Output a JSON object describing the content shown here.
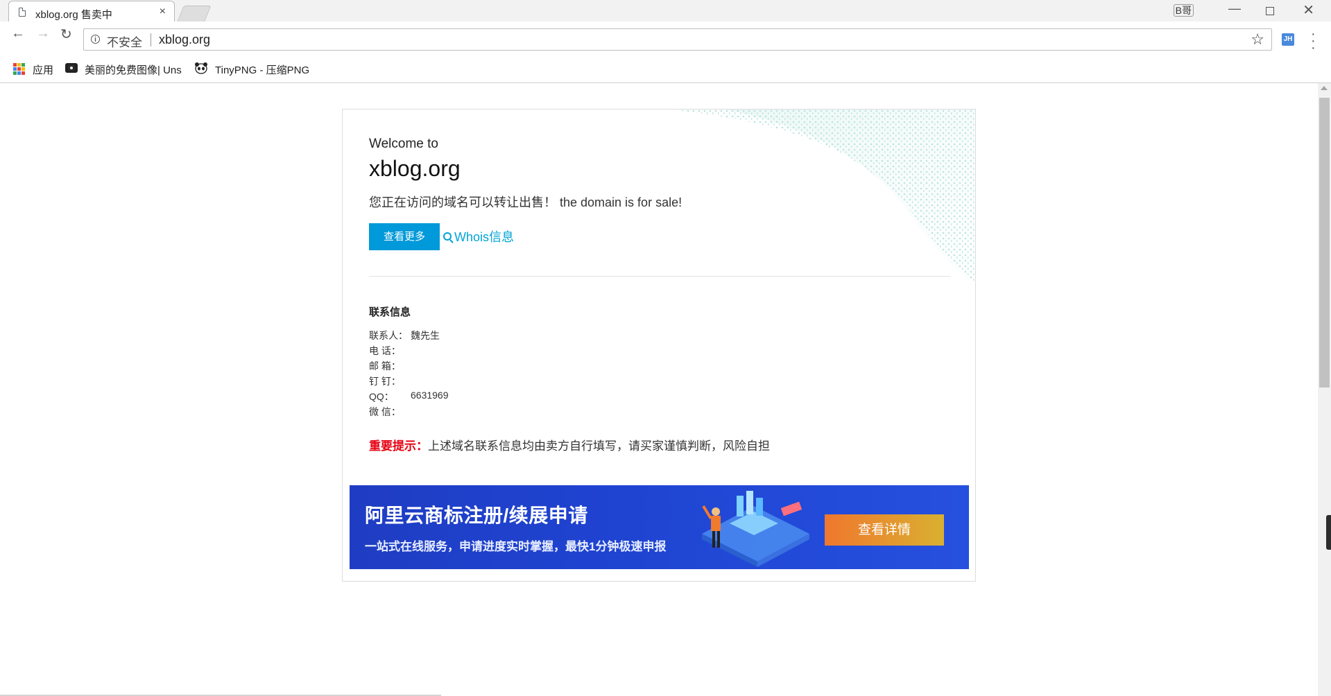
{
  "browser": {
    "tab_title": "xblog.org 售卖中",
    "tab_close": "×",
    "user_badge": "B哥",
    "window_min": "—",
    "window_close": "✕",
    "security_label": "不安全",
    "url": "xblog.org",
    "extension_badge": "JH",
    "bookmarks": [
      {
        "label": "应用",
        "icon": "apps-grid-icon"
      },
      {
        "label": "美丽的免费图像| Uns",
        "icon": "camera-icon"
      },
      {
        "label": "TinyPNG - 压缩PNG",
        "icon": "panda-icon"
      }
    ]
  },
  "page": {
    "welcome": "Welcome to",
    "domain": "xblog.org",
    "sale_text": "您正在访问的域名可以转让出售！ the domain is for sale!",
    "more_button": "查看更多",
    "whois_link": "Whois信息",
    "contact": {
      "title": "联系信息",
      "rows": [
        {
          "label": "联系人：",
          "value": "魏先生"
        },
        {
          "label": "电 话：",
          "value": ""
        },
        {
          "label": "邮 箱：",
          "value": ""
        },
        {
          "label": "钉 钉：",
          "value": ""
        },
        {
          "label": "QQ：",
          "value": "6631969"
        },
        {
          "label": "微 信：",
          "value": ""
        }
      ]
    },
    "notice_prefix": "重要提示：",
    "notice_text": "上述域名联系信息均由卖方自行填写，请买家谨慎判断，风险自担"
  },
  "banner": {
    "title": "阿里云商标注册/续展申请",
    "subtitle": "一站式在线服务，申请进度实时掌握，最快1分钟极速申报",
    "button": "查看详情"
  },
  "colors": {
    "primary_button": "#0099d9",
    "link": "#00a3d8",
    "warning": "#e60012",
    "banner_blue": "#1f44d2"
  }
}
